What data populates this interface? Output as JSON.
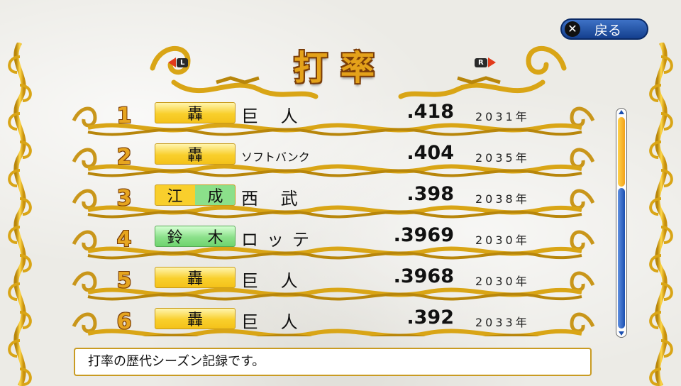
{
  "screen": {
    "title": "打率"
  },
  "nav": {
    "left_key": "L",
    "right_key": "R"
  },
  "back": {
    "icon": "x-icon",
    "label": "戻る"
  },
  "rows": [
    {
      "rank": "1",
      "player": "轟",
      "color": "yellow",
      "team": "巨 人",
      "avg": ".418",
      "year": "2031年"
    },
    {
      "rank": "2",
      "player": "轟",
      "color": "yellow",
      "team": "ソフトバンク",
      "avg": ".404",
      "year": "2035年"
    },
    {
      "rank": "3",
      "player": "江 成",
      "color": "mixed",
      "team": "西 武",
      "avg": ".398",
      "year": "2038年"
    },
    {
      "rank": "4",
      "player": "鈴 木",
      "color": "green",
      "team": "ロッテ",
      "avg": ".3969",
      "year": "2030年"
    },
    {
      "rank": "5",
      "player": "轟",
      "color": "yellow",
      "team": "巨 人",
      "avg": ".3968",
      "year": "2030年"
    },
    {
      "rank": "6",
      "player": "轟",
      "color": "yellow",
      "team": "巨 人",
      "avg": ".392",
      "year": "2033年"
    }
  ],
  "scroll": {
    "position": 0.33
  },
  "message": "打率の歴代シーズン記録です。",
  "colors": {
    "gold": "#e4a21a",
    "outline": "#7a3d08",
    "back_button": "#1b4fb0"
  }
}
